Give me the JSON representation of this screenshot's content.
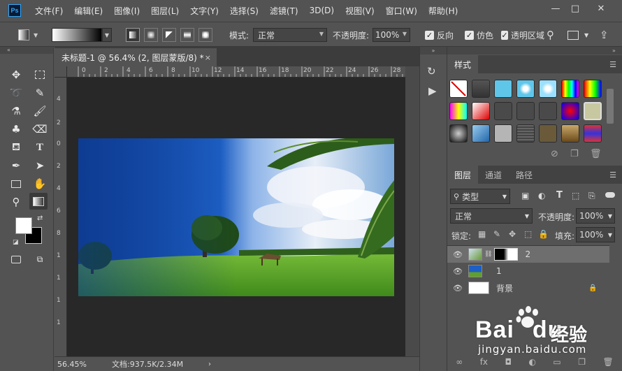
{
  "app": {
    "logo": "Ps"
  },
  "menu": [
    "文件(F)",
    "编辑(E)",
    "图像(I)",
    "图层(L)",
    "文字(Y)",
    "选择(S)",
    "滤镜(T)",
    "3D(D)",
    "视图(V)",
    "窗口(W)",
    "帮助(H)"
  ],
  "window_controls": {
    "minimize": "—",
    "maximize": "□",
    "close": "✕"
  },
  "options": {
    "mode_label": "模式:",
    "mode_value": "正常",
    "opacity_label": "不透明度:",
    "opacity_value": "100%",
    "reverse_label": "反向",
    "dither_label": "仿色",
    "transparency_label": "透明区域"
  },
  "document": {
    "tab_title": "未标题-1 @ 56.4% (2, 图层蒙版/8) *",
    "close": "×",
    "zoom": "56.45%",
    "doc_info": "文档:937.5K/2.34M",
    "ruler_top": [
      "0",
      "2",
      "4",
      "6",
      "8",
      "10",
      "12",
      "14",
      "16",
      "18",
      "20",
      "22",
      "24",
      "26",
      "28"
    ],
    "ruler_left": [
      "4",
      "2",
      "0",
      "2",
      "4",
      "6",
      "8",
      "1",
      "1",
      "1",
      "1"
    ]
  },
  "styles_panel": {
    "tab": "样式"
  },
  "layers_panel": {
    "tabs": [
      "图层",
      "通道",
      "路径"
    ],
    "filter_kind": "类型",
    "blend_mode": "正常",
    "opacity_label": "不透明度:",
    "opacity_value": "100%",
    "lock_label": "锁定:",
    "fill_label": "填充:",
    "fill_value": "100%",
    "layers": [
      {
        "name": "2",
        "selected": true
      },
      {
        "name": "1",
        "selected": false
      },
      {
        "name": "背景",
        "selected": false
      }
    ]
  },
  "watermark": {
    "brand": "Bai",
    "brand2": "du",
    "cn": "经验",
    "url": "jingyan.baidu.com"
  },
  "colors": {
    "bg": "#535353",
    "canvas": "#282828",
    "accent": "#31a8ff"
  }
}
